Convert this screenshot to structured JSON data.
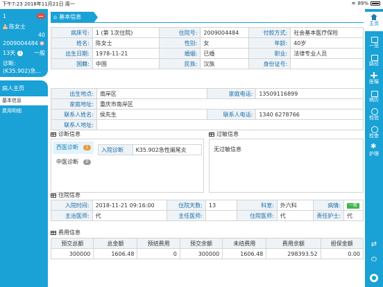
{
  "status_bar": {
    "time_date": "下午7:23  2018年11月21日 周一",
    "battery": "89%"
  },
  "patient_card": {
    "bed": "1",
    "name": "陈女士",
    "age": "40",
    "inpatient_no": "2009004484",
    "days": "13天",
    "days_count": "1",
    "level": "一般",
    "diagnosis_label": "诊断:",
    "diagnosis": "(K35.902)急..."
  },
  "left_nav": {
    "home": "病人主页",
    "basic_info": "基本信息",
    "fee_detail": "费用明细"
  },
  "right_nav": {
    "home": "主页",
    "overview": "一览",
    "path": "路径",
    "orders": "医嘱",
    "records": "病历",
    "test": "检验",
    "exam": "检查",
    "nursing": "护理"
  },
  "tab": {
    "title": "基本信息"
  },
  "basic": {
    "rows": [
      [
        {
          "l": "病床号:",
          "v": "1         (第 1次住院)"
        },
        {
          "l": "住院号:",
          "v": "2009004484"
        },
        {
          "l": "付款方式:",
          "v": "社会基本医疗保险"
        }
      ],
      [
        {
          "l": "姓名:",
          "v": "陈女士"
        },
        {
          "l": "性别:",
          "v": "女"
        },
        {
          "l": "年龄:",
          "v": "40岁"
        }
      ],
      [
        {
          "l": "出生日期:",
          "v": "1978-11-21"
        },
        {
          "l": "婚姻:",
          "v": "已婚"
        },
        {
          "l": "职业:",
          "v": "法律专业人员"
        }
      ],
      [
        {
          "l": "国籍:",
          "v": "中国"
        },
        {
          "l": "民族:",
          "v": "汉族"
        },
        {
          "l": "身份证号:",
          "v": ""
        }
      ]
    ]
  },
  "contact": {
    "birth_place_label": "出生地点:",
    "birth_place": "南岸区",
    "home_phone_label": "家庭电话:",
    "home_phone": "13509116899",
    "home_addr_label": "家庭地址:",
    "home_addr": "重庆市南岸区",
    "contact_name_label": "联系人姓名:",
    "contact_name": "侯先生",
    "contact_phone_label": "联系人电话:",
    "contact_phone": "1340 6278766",
    "contact_addr_label": "联系人地址:",
    "contact_addr": ""
  },
  "diagnosis": {
    "title": "诊断信息",
    "tab_western": "西医诊断",
    "western_count": "1",
    "tab_chinese": "中医诊断",
    "chinese_count": "0",
    "admit_label": "入院诊断",
    "admit_value": "K35.902急性阑尾炎"
  },
  "allergy": {
    "title": "过敏信息",
    "text": "无过敏信息"
  },
  "hospital": {
    "title": "住院信息",
    "admit_time_label": "入院时间:",
    "admit_time": "2018-11-21 09:16:00",
    "days_label": "住院天数:",
    "days": "13",
    "dept_label": "科室:",
    "dept": "外六科",
    "condition_label": "病情:",
    "condition": "一般",
    "attending_label": "主治医师:",
    "attending": "代",
    "chief_label": "主任医师:",
    "chief": "",
    "resident_label": "住院医师:",
    "resident": "代",
    "nurse_label": "责任护士:",
    "nurse": "代"
  },
  "fees": {
    "title": "费用信息",
    "headers": [
      "预交总额",
      "总金额",
      "预结费用",
      "预交余额",
      "未结费用",
      "费用余额",
      "担保金额"
    ],
    "values": [
      "300000",
      "1606.48",
      "0",
      "300000",
      "1606.48",
      "298393.52",
      "0.00"
    ]
  },
  "colors": {
    "accent": "#1aa1d6",
    "badge_red": "#e8473b",
    "label_blue": "#1a6ca8",
    "condition_green": "#3bb44a"
  }
}
